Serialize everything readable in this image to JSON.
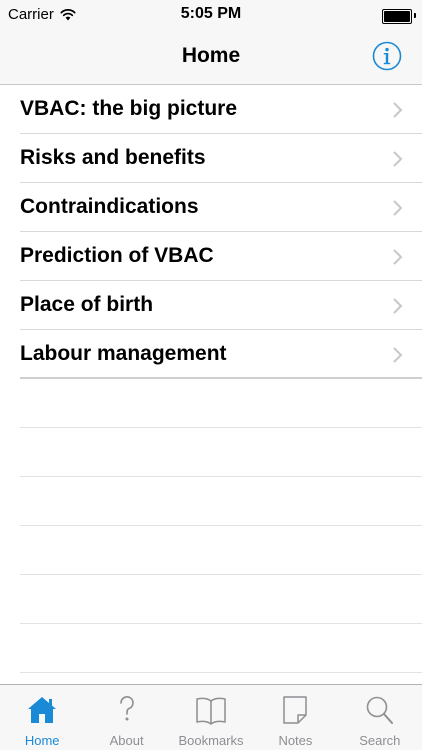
{
  "status_bar": {
    "carrier": "Carrier",
    "time": "5:05 PM",
    "icons": [
      "wifi-icon",
      "battery-icon"
    ]
  },
  "nav": {
    "title": "Home",
    "info_icon": "info-icon"
  },
  "menu": {
    "items": [
      {
        "label": "VBAC: the big picture"
      },
      {
        "label": "Risks and benefits"
      },
      {
        "label": "Contraindications"
      },
      {
        "label": "Prediction of VBAC"
      },
      {
        "label": "Place of birth"
      },
      {
        "label": "Labour management"
      }
    ],
    "chevron_icon": "chevron-right-icon"
  },
  "tabs": {
    "items": [
      {
        "label": "Home",
        "icon": "home-icon",
        "active": true
      },
      {
        "label": "About",
        "icon": "question-icon",
        "active": false
      },
      {
        "label": "Bookmarks",
        "icon": "book-icon",
        "active": false
      },
      {
        "label": "Notes",
        "icon": "note-icon",
        "active": false
      },
      {
        "label": "Search",
        "icon": "search-icon",
        "active": false
      }
    ]
  },
  "colors": {
    "accent": "#1a8ad6",
    "inactive": "#8e8e93",
    "bar_background": "#f7f7f7"
  }
}
